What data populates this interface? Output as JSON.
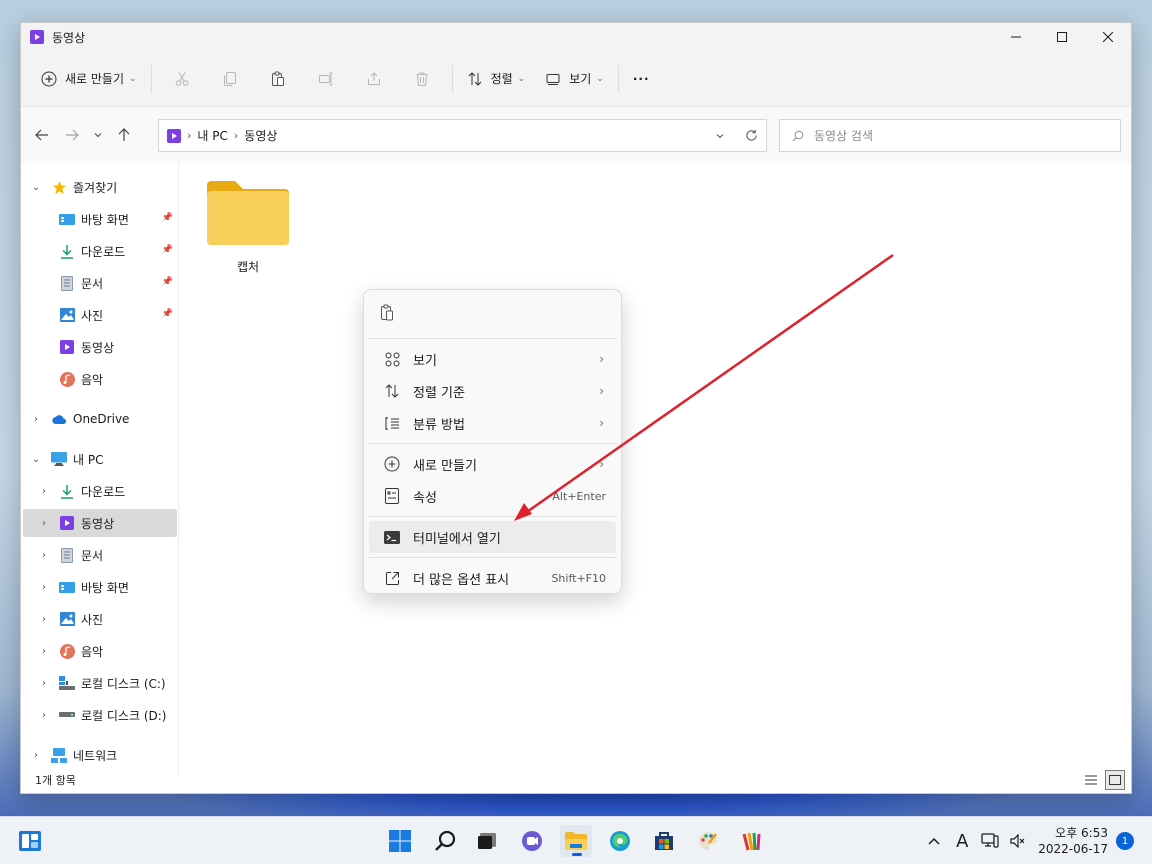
{
  "window": {
    "title": "동영상",
    "controls": [
      "minimize",
      "maximize",
      "close"
    ]
  },
  "commandbar": {
    "new_label": "새로 만들기",
    "sort_label": "정렬",
    "view_label": "보기",
    "more_label": "···"
  },
  "address": {
    "crumbs": [
      "내 PC",
      "동영상"
    ],
    "search_placeholder": "동영상 검색"
  },
  "sidebar": {
    "favorites": {
      "label": "즐겨찾기",
      "items": [
        {
          "label": "바탕 화면"
        },
        {
          "label": "다운로드"
        },
        {
          "label": "문서"
        },
        {
          "label": "사진"
        },
        {
          "label": "동영상"
        },
        {
          "label": "음악"
        }
      ]
    },
    "onedrive": {
      "label": "OneDrive"
    },
    "thispc": {
      "label": "내 PC",
      "items": [
        {
          "label": "다운로드"
        },
        {
          "label": "동영상"
        },
        {
          "label": "문서"
        },
        {
          "label": "바탕 화면"
        },
        {
          "label": "사진"
        },
        {
          "label": "음악"
        },
        {
          "label": "로컬 디스크 (C:)"
        },
        {
          "label": "로컬 디스크 (D:)"
        }
      ]
    },
    "network": {
      "label": "네트워크"
    }
  },
  "content": {
    "folders": [
      {
        "name": "캡처"
      }
    ]
  },
  "status": {
    "item_count": "1개 항목"
  },
  "context_menu": {
    "items": [
      {
        "label": "보기",
        "icon": "grid-icon",
        "submenu": true
      },
      {
        "label": "정렬 기준",
        "icon": "sort-icon",
        "submenu": true
      },
      {
        "label": "분류 방법",
        "icon": "group-icon",
        "submenu": true
      },
      {
        "label": "새로 만들기",
        "icon": "plus-circle-icon",
        "submenu": true
      },
      {
        "label": "속성",
        "icon": "properties-icon",
        "shortcut": "Alt+Enter"
      },
      {
        "label": "터미널에서 열기",
        "icon": "terminal-icon",
        "highlighted": true
      },
      {
        "label": "더 많은 옵션 표시",
        "icon": "expand-icon",
        "shortcut": "Shift+F10"
      }
    ]
  },
  "taskbar": {
    "clock_time": "오후 6:53",
    "clock_date": "2022-06-17",
    "notification_count": "1",
    "input_indicator": "A"
  },
  "colors": {
    "accent": "#0a64d6",
    "annotation_arrow": "#e0202a",
    "folder_yellow": "#f6c343"
  }
}
